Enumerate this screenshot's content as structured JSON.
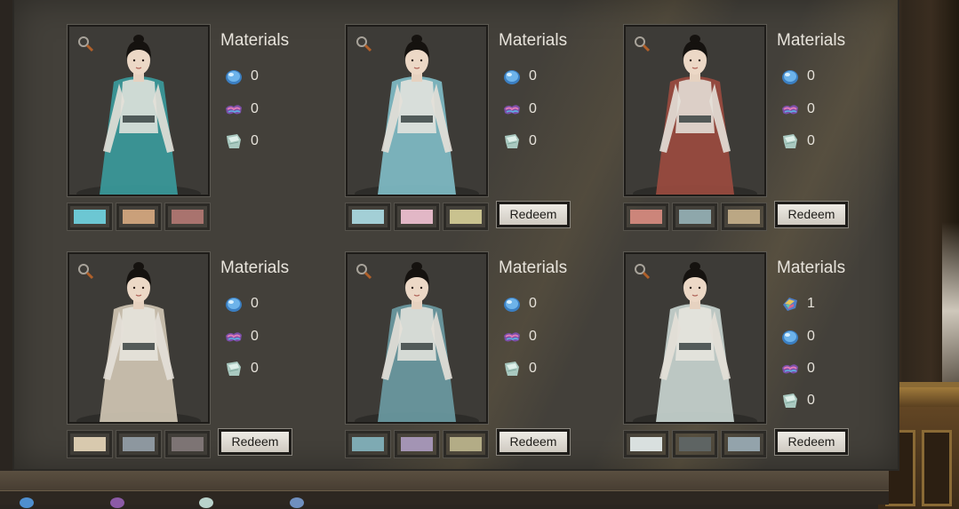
{
  "title_label": "Materials",
  "redeem_label": "Redeem",
  "cards": [
    {
      "materials": [
        {
          "icon": "blue-orb-icon",
          "value": "0"
        },
        {
          "icon": "silk-bundle-icon",
          "value": "0"
        },
        {
          "icon": "cloth-icon",
          "value": "0"
        }
      ],
      "swatches": [
        "#6cc7d3",
        "#caa07a",
        "#a9736e"
      ],
      "accent": "#3a9a9b",
      "redeem": false
    },
    {
      "materials": [
        {
          "icon": "blue-orb-icon",
          "value": "0"
        },
        {
          "icon": "silk-bundle-icon",
          "value": "0"
        },
        {
          "icon": "cloth-icon",
          "value": "0"
        }
      ],
      "swatches": [
        "#a3cfd6",
        "#e2b7c6",
        "#c9c28f"
      ],
      "accent": "#7fbcc6",
      "redeem": true
    },
    {
      "materials": [
        {
          "icon": "blue-orb-icon",
          "value": "0"
        },
        {
          "icon": "silk-bundle-icon",
          "value": "0"
        },
        {
          "icon": "cloth-icon",
          "value": "0"
        }
      ],
      "swatches": [
        "#cc857a",
        "#8ea7ab",
        "#bba784"
      ],
      "accent": "#9a4b3f",
      "redeem": true
    },
    {
      "materials": [
        {
          "icon": "blue-orb-icon",
          "value": "0"
        },
        {
          "icon": "silk-bundle-icon",
          "value": "0"
        },
        {
          "icon": "cloth-icon",
          "value": "0"
        }
      ],
      "swatches": [
        "#d8c9ae",
        "#8d979f",
        "#7d7474"
      ],
      "accent": "#cfc6b3",
      "redeem": true
    },
    {
      "materials": [
        {
          "icon": "blue-orb-icon",
          "value": "0"
        },
        {
          "icon": "silk-bundle-icon",
          "value": "0"
        },
        {
          "icon": "cloth-icon",
          "value": "0"
        }
      ],
      "swatches": [
        "#7eaab3",
        "#a394b4",
        "#b3ac86"
      ],
      "accent": "#6a9aa2",
      "redeem": true
    },
    {
      "materials": [
        {
          "icon": "rainbow-crystal-icon",
          "value": "1"
        },
        {
          "icon": "blue-orb-icon",
          "value": "0"
        },
        {
          "icon": "silk-bundle-icon",
          "value": "0"
        },
        {
          "icon": "cloth-icon",
          "value": "0"
        }
      ],
      "swatches": [
        "#d9e0df",
        "#5e6463",
        "#93a3ab"
      ],
      "accent": "#c7d4cf",
      "redeem": true
    }
  ],
  "bottom_bar": {
    "icons": [
      "blue-orb-icon",
      "silk-bundle-icon",
      "cloth-icon",
      "rainbow-crystal-icon"
    ]
  }
}
